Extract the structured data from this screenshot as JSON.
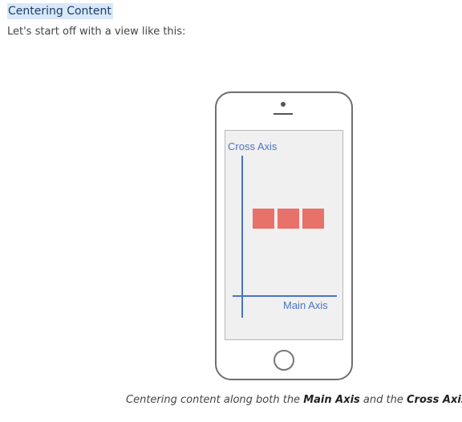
{
  "heading": "Centering Content",
  "intro": "Let's start off with a view like this:",
  "figure": {
    "cross_axis_label": "Cross Axis",
    "main_axis_label": "Main Axis",
    "box_count": 3,
    "box_color": "#e8716a",
    "axis_color": "#4a74c4"
  },
  "caption": {
    "part1": "Centering content along both the ",
    "main_axis": "Main Axis",
    "part2": " and the ",
    "cross_axis": "Cross Axis",
    "part3": "."
  }
}
